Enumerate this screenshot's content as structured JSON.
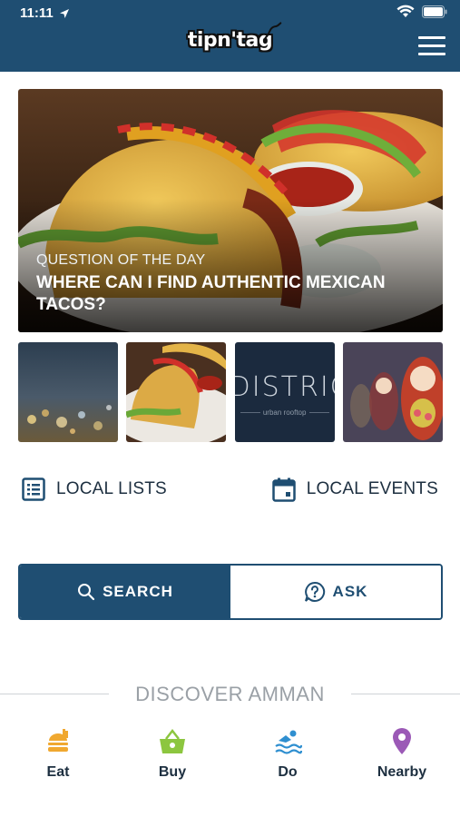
{
  "status_bar": {
    "time": "11:11"
  },
  "header": {
    "logo_text": "tipn'tag"
  },
  "hero": {
    "kicker": "QUESTION OF THE DAY",
    "title": "WHERE CAN I FIND AUTHENTIC MEXICAN TACOS?"
  },
  "thumbnails": [
    {
      "name": "city-lights"
    },
    {
      "name": "tacos"
    },
    {
      "name": "district",
      "title": "DISTRIC",
      "subtitle": "urban rooftop"
    },
    {
      "name": "matryoshka-dolls"
    }
  ],
  "local": {
    "lists_label": "LOCAL LISTS",
    "events_label": "LOCAL EVENTS"
  },
  "actions": {
    "search_label": "SEARCH",
    "ask_label": "ASK"
  },
  "discover": {
    "title": "DISCOVER AMMAN",
    "items": [
      {
        "label": "Eat",
        "icon": "burger-icon",
        "color": "#f0a830"
      },
      {
        "label": "Buy",
        "icon": "basket-icon",
        "color": "#8cc63f"
      },
      {
        "label": "Do",
        "icon": "swimmer-icon",
        "color": "#2f8fd0"
      },
      {
        "label": "Nearby",
        "icon": "location-pin-icon",
        "color": "#9b59b6"
      }
    ]
  },
  "colors": {
    "brand": "#1f4e72"
  }
}
